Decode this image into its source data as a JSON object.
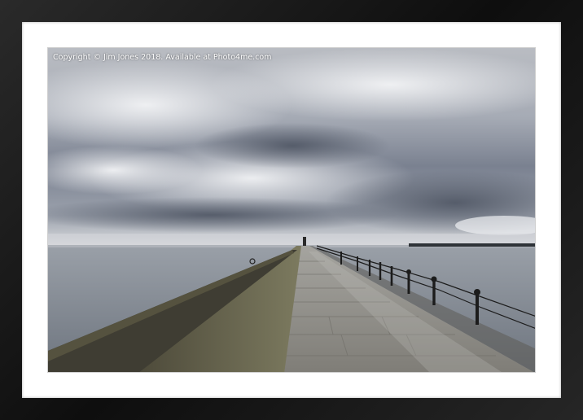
{
  "photo": {
    "watermark": "Copyright  © Jim Jones  2018. Available at Photo4me.com",
    "subject": "Stone pier with lighthouse under cloudy sky"
  },
  "colors": {
    "frame": "#141414",
    "mount": "#ffffff",
    "sky_light": "#d9dbe0",
    "sky_dark": "#5a6270",
    "sea": "#7f8791",
    "pier_wall": "#6b6b52",
    "pavement": "#8e8c86"
  }
}
